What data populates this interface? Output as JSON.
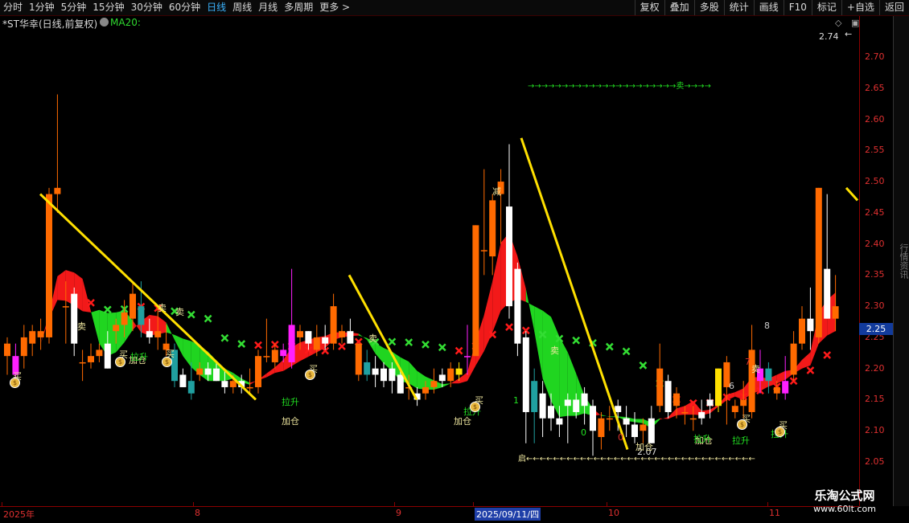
{
  "toolbar": {
    "periods": [
      "分时",
      "1分钟",
      "5分钟",
      "15分钟",
      "30分钟",
      "60分钟",
      "日线",
      "周线",
      "月线",
      "多周期",
      "更多 >"
    ],
    "active_period": "日线",
    "tools": [
      "复权",
      "叠加",
      "多股",
      "统计",
      "画线",
      "F10",
      "标记",
      "+自选",
      "返回"
    ]
  },
  "chart": {
    "title": "*ST华幸(日线,前复权)",
    "indicator": "MA20:",
    "high_mark": "2.74",
    "low_mark": "2.07",
    "current_price": "2.25",
    "colors": {
      "up": "#ff6a00",
      "up_hollow": "#e03040",
      "down": "#ffffff",
      "magenta": "#ff20ff",
      "teal": "#20a0a0",
      "yellow": "#ffe000",
      "band_up": "#ff1a1a",
      "band_down": "#22e022",
      "cross": "#33dd33"
    }
  },
  "y_axis": {
    "ticks": [
      "2.70",
      "2.65",
      "2.60",
      "2.55",
      "2.50",
      "2.45",
      "2.40",
      "2.35",
      "2.30",
      "2.25",
      "2.20",
      "2.15",
      "2.10",
      "2.05"
    ]
  },
  "x_axis": {
    "labels": [
      "2025年",
      "8",
      "9",
      "2025/09/11/四",
      "10",
      "11"
    ]
  },
  "signals": {
    "buy": "买",
    "sell": "卖",
    "add": "加仓",
    "lift": "拉升",
    "reduce": "减",
    "start": "启",
    "sell_arrow_row": "→→→→→→→→→→→→→→→→→→→→→→卖→→→→",
    "start_arrow_row": "启←←←←←←←←←←←←←←←←←←←←←←←←←←←←←←←←←←",
    "numbers": [
      "0",
      "1",
      "6",
      "7",
      "8",
      "0"
    ]
  },
  "side_strip": "行情资讯",
  "watermark": {
    "title": "乐淘公式网",
    "url": "www.60lt.com"
  },
  "chart_data": {
    "type": "candlestick",
    "ylim": [
      2.02,
      2.76
    ],
    "candles": [
      [
        2.22,
        2.25,
        2.19,
        2.24
      ],
      [
        2.22,
        2.24,
        2.17,
        2.19
      ],
      [
        2.22,
        2.27,
        2.2,
        2.25
      ],
      [
        2.24,
        2.27,
        2.22,
        2.26
      ],
      [
        2.25,
        2.28,
        2.23,
        2.26
      ],
      [
        2.25,
        2.49,
        2.24,
        2.48
      ],
      [
        2.48,
        2.64,
        2.45,
        2.49
      ],
      [
        2.3,
        2.34,
        2.24,
        2.3
      ],
      [
        2.32,
        2.33,
        2.22,
        2.24
      ],
      [
        2.21,
        2.23,
        2.18,
        2.21
      ],
      [
        2.21,
        2.24,
        2.2,
        2.22
      ],
      [
        2.22,
        2.24,
        2.21,
        2.23
      ],
      [
        2.24,
        2.26,
        2.2,
        2.2
      ],
      [
        2.26,
        2.28,
        2.24,
        2.27
      ],
      [
        2.27,
        2.31,
        2.25,
        2.29
      ],
      [
        2.28,
        2.34,
        2.26,
        2.32
      ],
      [
        2.27,
        2.34,
        2.25,
        2.3
      ],
      [
        2.26,
        2.28,
        2.24,
        2.25
      ],
      [
        2.25,
        2.3,
        2.23,
        2.26
      ],
      [
        2.23,
        2.27,
        2.22,
        2.24
      ],
      [
        2.23,
        2.24,
        2.17,
        2.18
      ],
      [
        2.19,
        2.2,
        2.17,
        2.17
      ],
      [
        2.18,
        2.21,
        2.15,
        2.16
      ],
      [
        2.19,
        2.21,
        2.18,
        2.2
      ],
      [
        2.2,
        2.21,
        2.18,
        2.19
      ],
      [
        2.2,
        2.21,
        2.18,
        2.18
      ],
      [
        2.18,
        2.2,
        2.16,
        2.17
      ],
      [
        2.17,
        2.19,
        2.16,
        2.18
      ],
      [
        2.18,
        2.19,
        2.16,
        2.17
      ],
      [
        2.17,
        2.2,
        2.16,
        2.17
      ],
      [
        2.17,
        2.23,
        2.16,
        2.22
      ],
      [
        2.22,
        2.28,
        2.21,
        2.22
      ],
      [
        2.21,
        2.24,
        2.2,
        2.23
      ],
      [
        2.22,
        2.24,
        2.21,
        2.23
      ],
      [
        2.21,
        2.36,
        2.2,
        2.27
      ],
      [
        2.25,
        2.27,
        2.23,
        2.26
      ],
      [
        2.26,
        2.26,
        2.23,
        2.24
      ],
      [
        2.23,
        2.27,
        2.22,
        2.25
      ],
      [
        2.25,
        2.27,
        2.23,
        2.24
      ],
      [
        2.24,
        2.32,
        2.23,
        2.3
      ],
      [
        2.25,
        2.27,
        2.24,
        2.26
      ],
      [
        2.26,
        2.28,
        2.24,
        2.24
      ],
      [
        2.19,
        2.24,
        2.18,
        2.24
      ],
      [
        2.21,
        2.23,
        2.18,
        2.19
      ],
      [
        2.2,
        2.22,
        2.17,
        2.19
      ],
      [
        2.2,
        2.21,
        2.17,
        2.18
      ],
      [
        2.2,
        2.21,
        2.16,
        2.18
      ],
      [
        2.19,
        2.2,
        2.16,
        2.16
      ],
      [
        2.17,
        2.19,
        2.15,
        2.17
      ],
      [
        2.16,
        2.17,
        2.14,
        2.15
      ],
      [
        2.16,
        2.18,
        2.15,
        2.17
      ],
      [
        2.17,
        2.2,
        2.16,
        2.18
      ],
      [
        2.19,
        2.2,
        2.17,
        2.18
      ],
      [
        2.18,
        2.21,
        2.17,
        2.2
      ],
      [
        2.2,
        2.21,
        2.18,
        2.19
      ],
      [
        2.22,
        2.27,
        2.19,
        2.22
      ],
      [
        2.22,
        2.43,
        2.22,
        2.43
      ],
      [
        2.39,
        2.52,
        2.35,
        2.39
      ],
      [
        2.38,
        2.48,
        2.35,
        2.47
      ],
      [
        2.48,
        2.52,
        2.4,
        2.5
      ],
      [
        2.46,
        2.56,
        2.28,
        2.3
      ],
      [
        2.36,
        2.37,
        2.22,
        2.24
      ],
      [
        2.25,
        2.26,
        2.08,
        2.13
      ],
      [
        2.18,
        2.2,
        2.08,
        2.13
      ],
      [
        2.16,
        2.18,
        2.09,
        2.12
      ],
      [
        2.14,
        2.16,
        2.1,
        2.12
      ],
      [
        2.12,
        2.14,
        2.09,
        2.11
      ],
      [
        2.15,
        2.16,
        2.08,
        2.14
      ],
      [
        2.15,
        2.16,
        2.12,
        2.13
      ],
      [
        2.16,
        2.17,
        2.11,
        2.14
      ],
      [
        2.14,
        2.15,
        2.06,
        2.1
      ],
      [
        2.09,
        2.13,
        2.07,
        2.12
      ],
      [
        2.12,
        2.14,
        2.1,
        2.12
      ],
      [
        2.14,
        2.15,
        2.1,
        2.13
      ],
      [
        2.12,
        2.14,
        2.09,
        2.11
      ],
      [
        2.11,
        2.13,
        2.08,
        2.09
      ],
      [
        2.1,
        2.12,
        2.08,
        2.11
      ],
      [
        2.12,
        2.14,
        2.08,
        2.08
      ],
      [
        2.14,
        2.24,
        2.13,
        2.2
      ],
      [
        2.18,
        2.19,
        2.12,
        2.13
      ],
      [
        2.14,
        2.17,
        2.12,
        2.16
      ],
      [
        2.13,
        2.14,
        2.11,
        2.13
      ],
      [
        2.12,
        2.14,
        2.1,
        2.12
      ],
      [
        2.13,
        2.15,
        2.11,
        2.12
      ],
      [
        2.15,
        2.16,
        2.12,
        2.14
      ],
      [
        2.14,
        2.2,
        2.13,
        2.2
      ],
      [
        2.17,
        2.22,
        2.11,
        2.21
      ],
      [
        2.13,
        2.15,
        2.12,
        2.14
      ],
      [
        2.14,
        2.18,
        2.12,
        2.15
      ],
      [
        2.13,
        2.27,
        2.12,
        2.23
      ],
      [
        2.18,
        2.23,
        2.16,
        2.2
      ],
      [
        2.18,
        2.21,
        2.16,
        2.2
      ],
      [
        2.16,
        2.18,
        2.15,
        2.17
      ],
      [
        2.16,
        2.22,
        2.15,
        2.18
      ],
      [
        2.19,
        2.26,
        2.18,
        2.24
      ],
      [
        2.24,
        2.3,
        2.23,
        2.28
      ],
      [
        2.28,
        2.33,
        2.23,
        2.26
      ],
      [
        2.25,
        2.49,
        2.24,
        2.49
      ],
      [
        2.36,
        2.48,
        2.28,
        2.28
      ],
      [
        2.28,
        2.35,
        2.26,
        2.3
      ]
    ]
  }
}
